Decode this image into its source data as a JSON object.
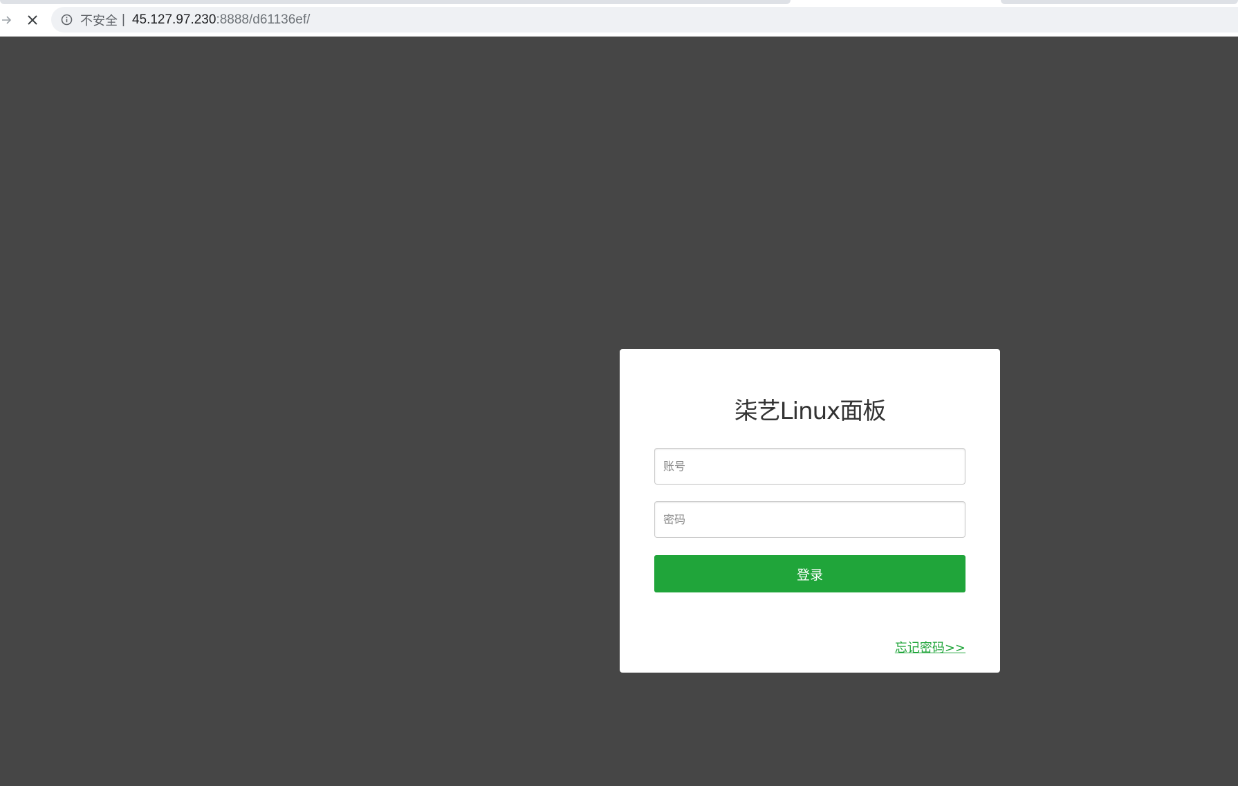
{
  "browser": {
    "security_label": "不安全",
    "separator": "|",
    "url_host": "45.127.97.230",
    "url_rest": ":8888/d61136ef/",
    "icons": {
      "forward": "forward-arrow-icon",
      "stop": "close-icon",
      "info": "info-icon"
    }
  },
  "login": {
    "title": "柒艺Linux面板",
    "username_placeholder": "账号",
    "password_placeholder": "密码",
    "submit_label": "登录",
    "forgot_link": "忘记密码>>"
  },
  "colors": {
    "page_background": "#464646",
    "accent": "#20a53a",
    "card_background": "#ffffff"
  }
}
